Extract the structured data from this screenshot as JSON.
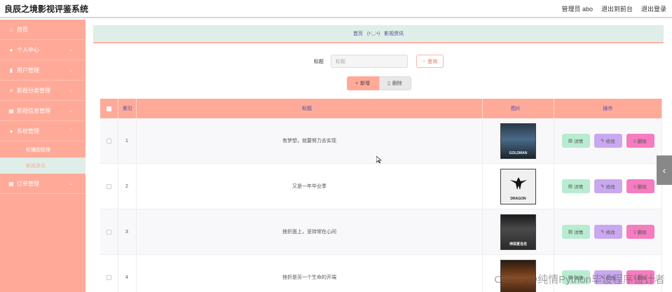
{
  "app": {
    "title": "良辰之境影视评鉴系统",
    "user_text": "管理员 abo",
    "back_to_front": "退出到前台",
    "logout": "退出登录"
  },
  "sidebar": {
    "items": [
      {
        "label": "首页",
        "icon": "home-icon"
      },
      {
        "label": "个人中心",
        "icon": "user-icon"
      },
      {
        "label": "用户管理",
        "icon": "chart-icon"
      },
      {
        "label": "影视分类管理",
        "icon": "list-icon"
      },
      {
        "label": "影视信息管理",
        "icon": "grid-icon"
      },
      {
        "label": "系统管理",
        "icon": "bulb-icon"
      }
    ],
    "submenu": [
      {
        "label": "轮播图管理"
      },
      {
        "label": "影视资讯"
      }
    ],
    "order": {
      "label": "订单管理",
      "icon": "grid-icon"
    }
  },
  "breadcrumb": {
    "home": "首页",
    "emoticon": "(•'◡'•)",
    "current": "影视资讯"
  },
  "search": {
    "label": "标题",
    "placeholder": "标题",
    "button": "查询"
  },
  "toolbar": {
    "add": "新增",
    "delete": "删除"
  },
  "table": {
    "headers": {
      "index": "索引",
      "title": "标题",
      "picture": "图片",
      "ops": "操作"
    },
    "rows": [
      {
        "index": "1",
        "title": "有梦想，就要努力去实现",
        "poster_caption": "GOLDMAN"
      },
      {
        "index": "2",
        "title": "又是一年毕业季",
        "poster_caption": "DRAGON"
      },
      {
        "index": "3",
        "title": "挫折面上，坚持常在心间",
        "poster_caption": "神探夏洛克"
      },
      {
        "index": "4",
        "title": "挫折是另一个生命的开端",
        "poster_caption": ""
      }
    ],
    "op_labels": {
      "detail": "详情",
      "edit": "修改",
      "delete": "删除"
    }
  },
  "watermark": "CSDN @纯情Python毕设程序设计者",
  "colors": {
    "sidebar": "#ffaa99",
    "breadcrumb_bg": "#dfeee8",
    "detail": "#b8ecd0",
    "edit": "#c9a8ef",
    "delete": "#f57cbf"
  }
}
